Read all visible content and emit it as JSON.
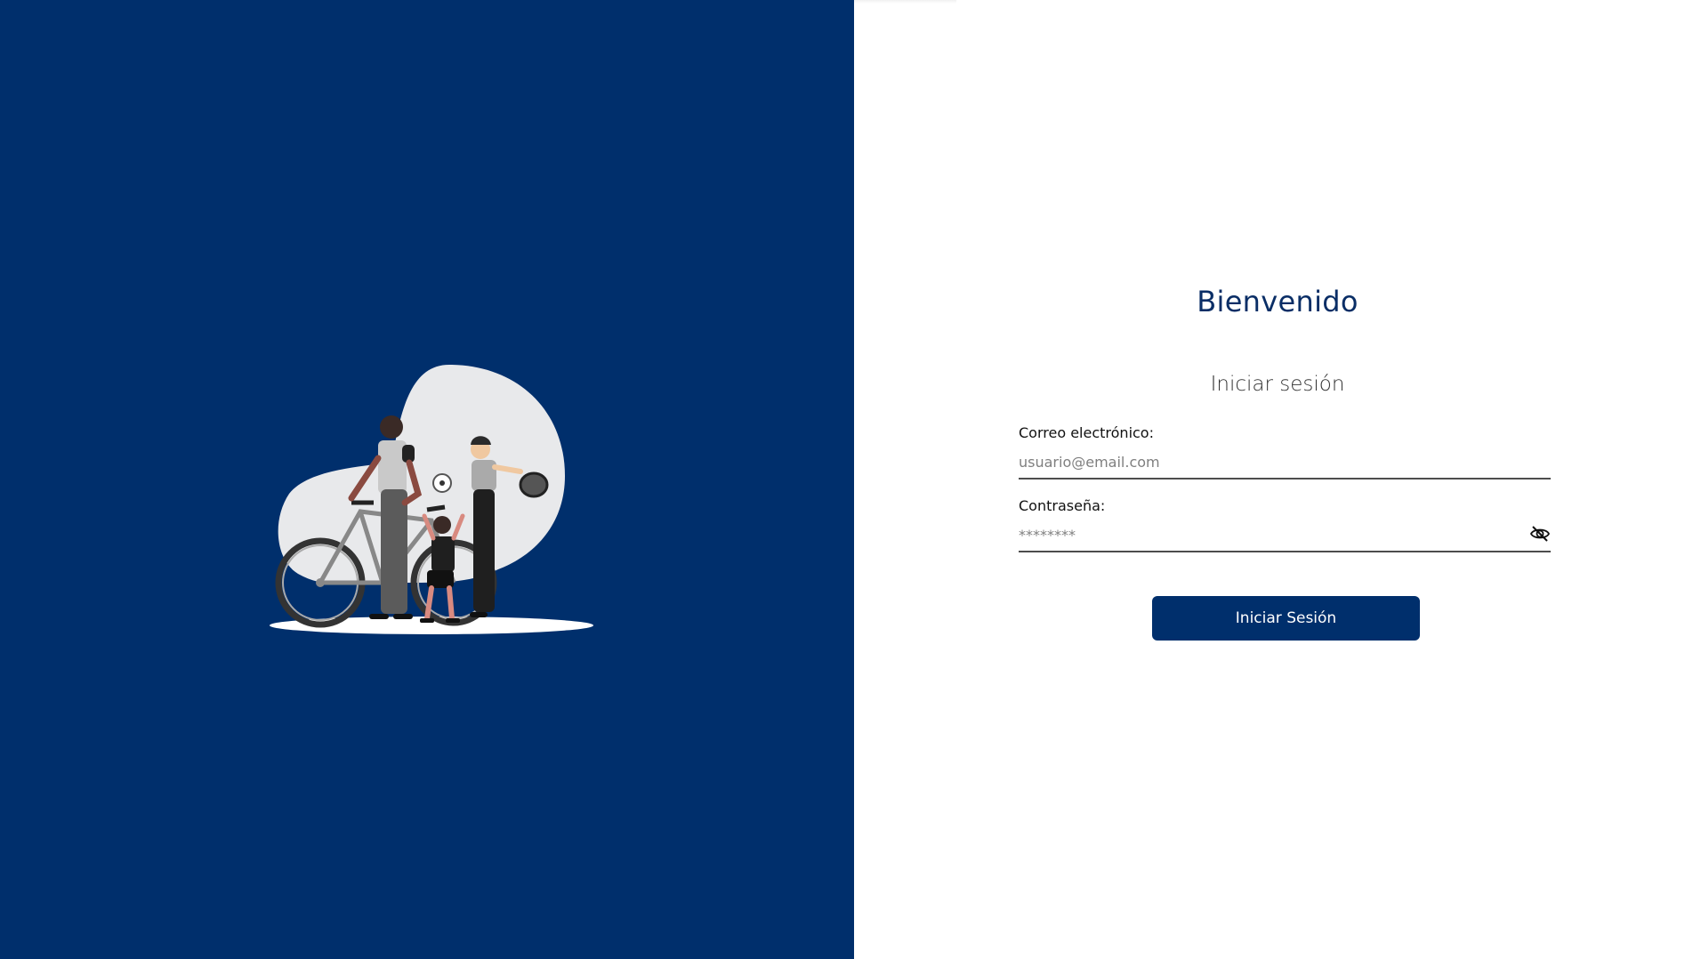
{
  "colors": {
    "brand_primary": "#002f6c",
    "text_primary": "#0a2e66",
    "background": "#ffffff"
  },
  "illustration": {
    "description_icon": "family-sports-illustration-icon"
  },
  "login": {
    "welcome": "Bienvenido",
    "subtitle": "Iniciar sesión",
    "email": {
      "label": "Correo electrónico:",
      "placeholder": "usuario@email.com",
      "value": ""
    },
    "password": {
      "label": "Contraseña:",
      "placeholder": "********",
      "value": "",
      "toggle_icon": "eye-off-icon"
    },
    "submit_label": "Iniciar Sesión"
  }
}
